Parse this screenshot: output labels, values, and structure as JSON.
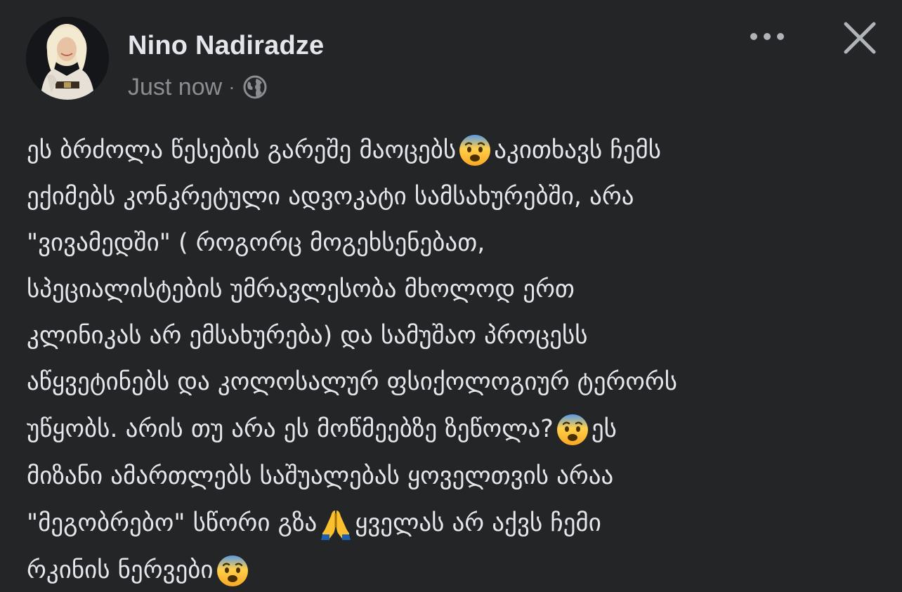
{
  "post": {
    "author": "Nino Nadiradze",
    "timestamp": "Just now",
    "separator": "·",
    "audience_icon": "globe-icon",
    "avatar_icon": "profile-photo",
    "more_icon": "more-options-icon",
    "close_icon": "close-icon"
  },
  "body": {
    "l1a": "ეს ბრძოლა წესების გარეშე მაოცებს",
    "l1b": " აკითხავს ჩემს",
    "l2": "ექიმებს კონკრეტული ადვოკატი სამსახურებში, არა",
    "l3": "\"ვივამედში\" ( როგორც მოგეხსენებათ,",
    "l4": "სპეციალისტების უმრავლესობა მხოლოდ ერთ",
    "l5": "კლინიკას არ ემსახურება) და სამუშაო პროცესს",
    "l6": "აწყვეტინებს და კოლოსალურ ფსიქოლოგიურ ტერორს",
    "l7a": "უწყობს. არის თუ არა ეს მოწმეებზე ზეწოლა?",
    "l7b": " ეს",
    "l8": "მიზანი ამართლებს საშუალებას ყოველთვის არაა",
    "l9a": "\"მეგობრებო\" სწორი გზა",
    "l9b": " ყველას არ აქვს ჩემი",
    "l10a": "რკინის ნერვები"
  },
  "emojis": {
    "fearful": "fearful-face-emoji",
    "pray": "folded-hands-emoji"
  },
  "colors": {
    "background": "#242527",
    "text": "#e4e6eb",
    "secondary": "#8a8d91"
  }
}
